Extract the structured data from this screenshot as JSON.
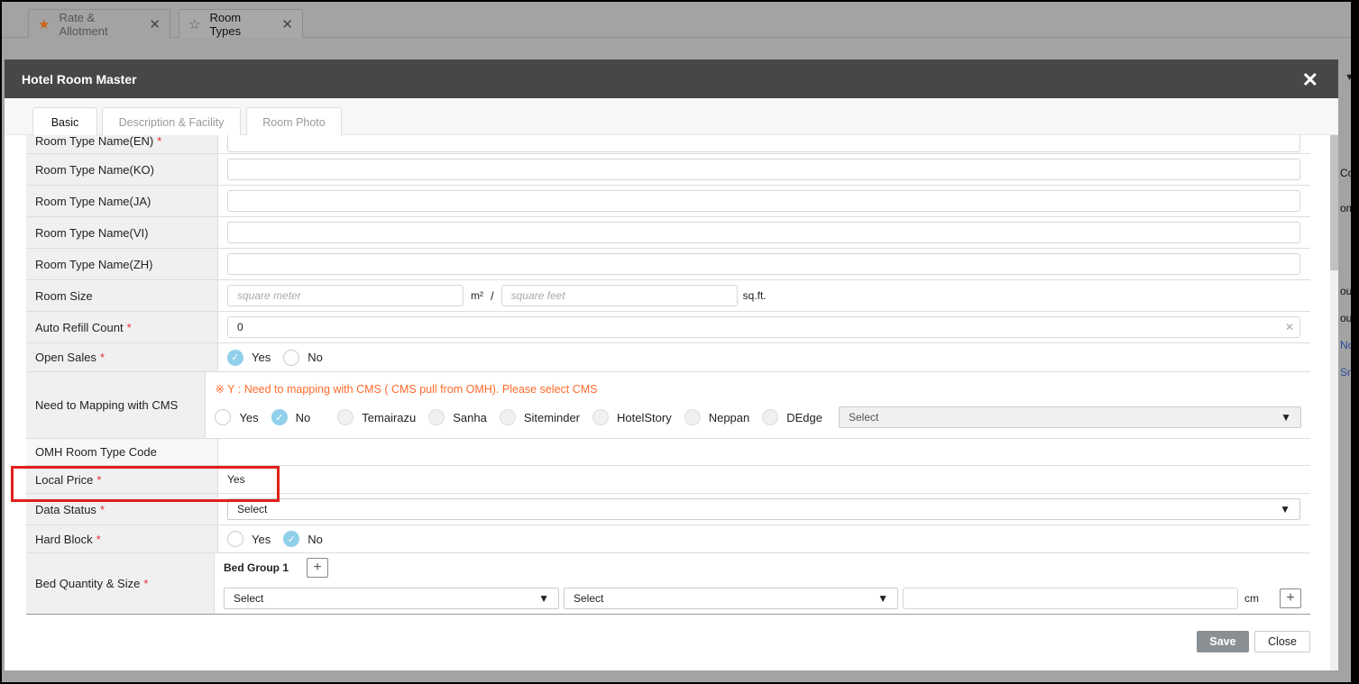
{
  "page_tabs": [
    {
      "label": "Rate & Allotment",
      "icon": "star-filled-icon"
    },
    {
      "label": "Room Types",
      "icon": "star-outline-icon"
    }
  ],
  "background_fragments": [
    "Cop",
    "om",
    "oub",
    "oub",
    "Non",
    "Smo"
  ],
  "modal": {
    "title": "Hotel Room Master",
    "tabs": [
      "Basic",
      "Description & Facility",
      "Room Photo"
    ],
    "active_tab": "Basic"
  },
  "form": {
    "room_name_en": "Room Type Name(EN)",
    "room_name_ko": "Room Type Name(KO)",
    "room_name_ja": "Room Type Name(JA)",
    "room_name_vi": "Room Type Name(VI)",
    "room_name_zh": "Room Type Name(ZH)",
    "room_size": {
      "label": "Room Size",
      "sqm_placeholder": "square meter",
      "sqm_unit": "m²",
      "sep": "/",
      "sqft_placeholder": "square feet",
      "sqft_unit": "sq.ft."
    },
    "auto_refill": {
      "label": "Auto Refill Count",
      "value": "0",
      "clear": "✕"
    },
    "open_sales": {
      "label": "Open Sales",
      "yes": "Yes",
      "no": "No",
      "selected": "Yes"
    },
    "cms": {
      "label": "Need to Mapping with CMS",
      "notice": "※ Y : Need to mapping with CMS ( CMS pull from OMH). Please select CMS",
      "yes": "Yes",
      "no": "No",
      "selected": "No",
      "options": [
        "Temairazu",
        "Sanha",
        "Siteminder",
        "HotelStory",
        "Neppan",
        "DEdge"
      ],
      "select": "Select"
    },
    "omh_code": {
      "label": "OMH Room Type Code",
      "value": ""
    },
    "local_price": {
      "label": "Local Price",
      "value": "Yes"
    },
    "data_status": {
      "label": "Data Status",
      "value": "Select"
    },
    "hard_block": {
      "label": "Hard Block",
      "yes": "Yes",
      "no": "No",
      "selected": "No"
    },
    "bed": {
      "label": "Bed Quantity & Size",
      "group": "Bed Group 1",
      "select1": "Select",
      "select2": "Select",
      "unit": "cm"
    },
    "required_mark": "*"
  },
  "footer": {
    "save": "Save",
    "close": "Close"
  },
  "colors": {
    "header": "#474747",
    "accent_radio": "#90d0ea",
    "notice": "#ff6a2a",
    "highlight": "#e0201c"
  }
}
